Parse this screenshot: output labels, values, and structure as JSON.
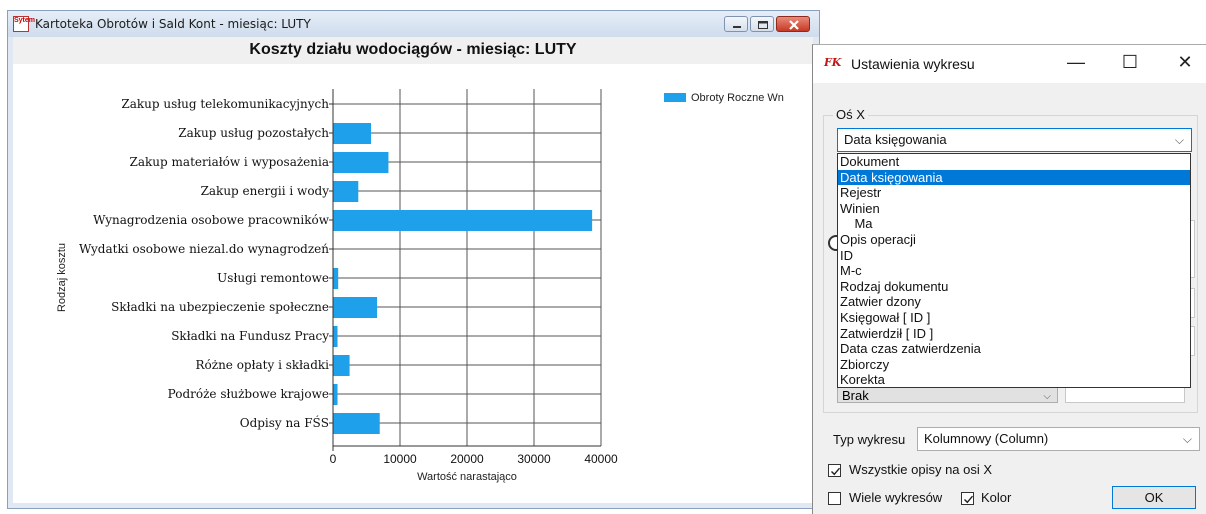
{
  "main_window": {
    "title": "Kartoteka Obrotów i Sald Kont  -  miesiąc:  LUTY",
    "app_icon_text": "Sytem",
    "chart_title": "Koszty działu wodociągów  -  miesiąc:  LUTY"
  },
  "chart_data": {
    "type": "bar",
    "orientation": "horizontal",
    "title": "Koszty działu wodociągów  -  miesiąc:  LUTY",
    "xlabel": "Wartość narastająco",
    "ylabel": "Rodzaj kosztu",
    "xlim": [
      0,
      40000
    ],
    "xticks": [
      "0",
      "10000",
      "20000",
      "30000",
      "40000"
    ],
    "grid": true,
    "legend_position": "top-right",
    "bar_color": "#1ea1ea",
    "categories": [
      "Zakup usług telekomunikacyjnych",
      "Zakup usług pozostałych",
      "Zakup materiałów i wyposażenia",
      "Zakup energii i wody",
      "Wynagrodzenia osobowe pracowników",
      "Wydatki osobowe niezal.do wynagrodzeń",
      "Usługi remontowe",
      "Składki na ubezpieczenie społeczne",
      "Składki na Fundusz Pracy",
      "Różne opłaty i składki",
      "Podróże służbowe krajowe",
      "Odpisy na FŚS"
    ],
    "series": [
      {
        "name": "Obroty Roczne Wn",
        "values": [
          0,
          5600,
          8200,
          3700,
          38600,
          0,
          700,
          6500,
          600,
          2400,
          600,
          6900
        ]
      }
    ]
  },
  "dialog": {
    "title": "Ustawienia wykresu",
    "icon_text": "FK",
    "minimize": "—",
    "maximize": "☐",
    "close": "✕",
    "os_x_label": "Oś X",
    "os_x_value": "Data księgowania",
    "dropdown_options": [
      "Dokument",
      "Data księgowania",
      "Rejestr",
      "Winien",
      "    Ma",
      "Opis operacji",
      "ID",
      "M-c",
      "Rodzaj dokumentu",
      "Zatwier dzony",
      "Księgował [ ID ]",
      "Zatwierdził [ ID ]",
      "Data czas zatwierdzenia",
      "Zbiorczy",
      "Korekta"
    ],
    "selected_option_index": 1,
    "hidden_combo_value": "Brak",
    "typ_label": "Typ wykresu",
    "typ_value": "Kolumnowy (Column)",
    "wszystkie_label": "Wszystkie opisy na osi X",
    "wszystkie_checked": true,
    "wiele_label": "Wiele wykresów",
    "wiele_checked": false,
    "kolor_label": "Kolor",
    "kolor_checked": true,
    "ok_label": "OK"
  }
}
